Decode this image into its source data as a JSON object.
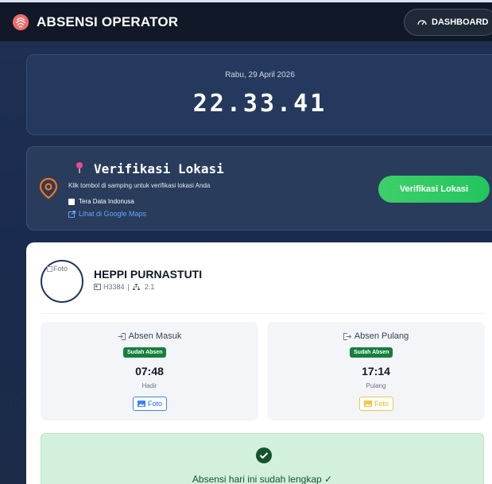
{
  "header": {
    "title": "ABSENSI OPERATOR",
    "logo_icon": "fingerprint-icon",
    "dashboard_label": "DASHBOARD",
    "dashboard_icon": "speedometer-icon"
  },
  "clock": {
    "date": "Rabu, 29 April 2026",
    "time": "22.33.41"
  },
  "location": {
    "title": "Verifikasi Lokasi",
    "description": "Klik tombol di samping untuk verifikasi lokasi Anda",
    "company": "Tera Data Indonusa",
    "maps_link": "Lihat di Google Maps",
    "verify_button": "Verifikasi Lokasi",
    "accent_color": "#22c55e"
  },
  "profile": {
    "avatar_alt": "Foto",
    "name": "HEPPI PURNASTUTI",
    "id": "H3384",
    "separator": "|",
    "unit": "2.1"
  },
  "attendance": {
    "in": {
      "label": "Absen Masuk",
      "badge": "Sudah Absen",
      "time": "07:48",
      "status": "Hadir",
      "foto_label": "Foto"
    },
    "out": {
      "label": "Absen Pulang",
      "badge": "Sudah Absen",
      "time": "17:14",
      "status": "Pulang",
      "foto_label": "Foto"
    }
  },
  "complete": {
    "message": "Absensi hari ini sudah lengkap ✓"
  }
}
